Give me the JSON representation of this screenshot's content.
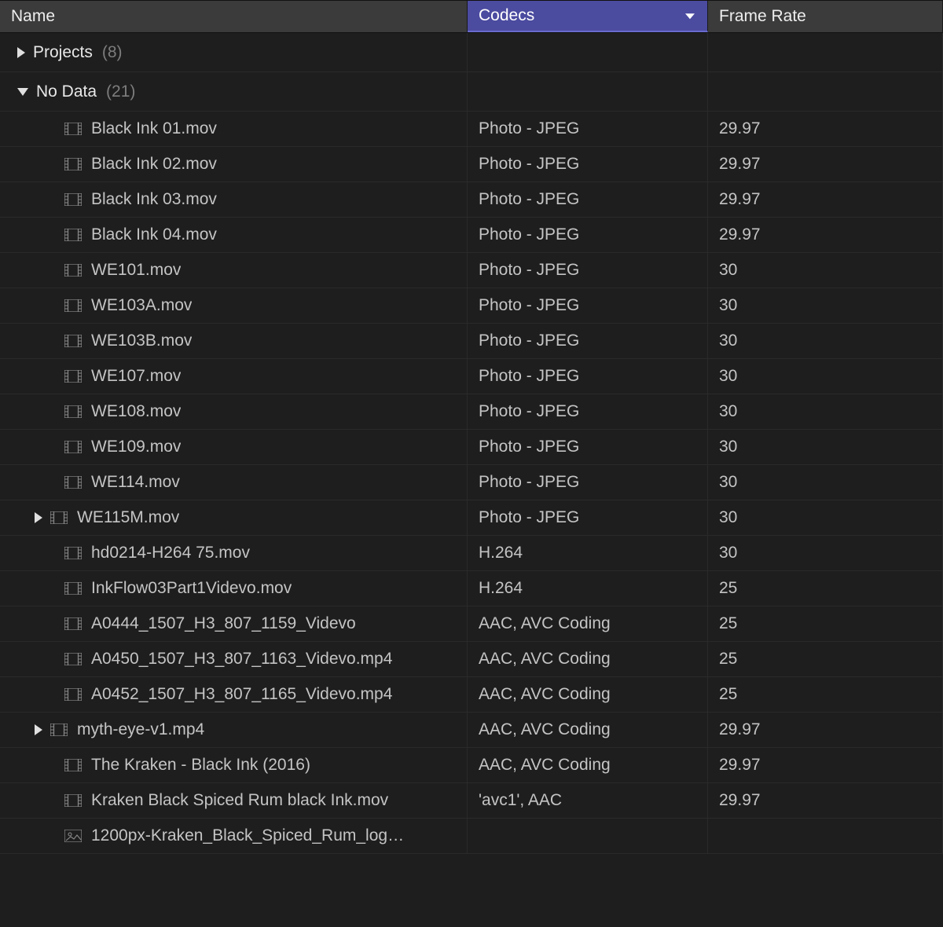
{
  "columns": {
    "name": "Name",
    "codecs": "Codecs",
    "rate": "Frame Rate"
  },
  "groups": [
    {
      "id": "projects",
      "label": "Projects",
      "count": "(8)",
      "expanded": false
    },
    {
      "id": "nodata",
      "label": "No Data",
      "count": "(21)",
      "expanded": true
    }
  ],
  "rows": [
    {
      "name": "Black Ink 01.mov",
      "codec": "Photo - JPEG",
      "rate": "29.97",
      "icon": "film",
      "disclosure": null
    },
    {
      "name": "Black Ink 02.mov",
      "codec": "Photo - JPEG",
      "rate": "29.97",
      "icon": "film",
      "disclosure": null
    },
    {
      "name": "Black Ink 03.mov",
      "codec": "Photo - JPEG",
      "rate": "29.97",
      "icon": "film",
      "disclosure": null
    },
    {
      "name": "Black Ink 04.mov",
      "codec": "Photo - JPEG",
      "rate": "29.97",
      "icon": "film",
      "disclosure": null
    },
    {
      "name": "WE101.mov",
      "codec": "Photo - JPEG",
      "rate": "30",
      "icon": "film",
      "disclosure": null
    },
    {
      "name": "WE103A.mov",
      "codec": "Photo - JPEG",
      "rate": "30",
      "icon": "film",
      "disclosure": null
    },
    {
      "name": "WE103B.mov",
      "codec": "Photo - JPEG",
      "rate": "30",
      "icon": "film",
      "disclosure": null
    },
    {
      "name": "WE107.mov",
      "codec": "Photo - JPEG",
      "rate": "30",
      "icon": "film",
      "disclosure": null
    },
    {
      "name": "WE108.mov",
      "codec": "Photo - JPEG",
      "rate": "30",
      "icon": "film",
      "disclosure": null
    },
    {
      "name": "WE109.mov",
      "codec": "Photo - JPEG",
      "rate": "30",
      "icon": "film",
      "disclosure": null
    },
    {
      "name": "WE114.mov",
      "codec": "Photo - JPEG",
      "rate": "30",
      "icon": "film",
      "disclosure": null
    },
    {
      "name": "WE115M.mov",
      "codec": "Photo - JPEG",
      "rate": "30",
      "icon": "film",
      "disclosure": "right"
    },
    {
      "name": "hd0214-H264 75.mov",
      "codec": "H.264",
      "rate": "30",
      "icon": "film",
      "disclosure": null
    },
    {
      "name": "InkFlow03Part1Videvo.mov",
      "codec": "H.264",
      "rate": "25",
      "icon": "film",
      "disclosure": null
    },
    {
      "name": "A0444_1507_H3_807_1159_Videvo",
      "codec": "AAC, AVC Coding",
      "rate": "25",
      "icon": "film",
      "disclosure": null
    },
    {
      "name": "A0450_1507_H3_807_1163_Videvo.mp4",
      "codec": "AAC, AVC Coding",
      "rate": "25",
      "icon": "film",
      "disclosure": null
    },
    {
      "name": "A0452_1507_H3_807_1165_Videvo.mp4",
      "codec": "AAC, AVC Coding",
      "rate": "25",
      "icon": "film",
      "disclosure": null
    },
    {
      "name": "myth-eye-v1.mp4",
      "codec": "AAC, AVC Coding",
      "rate": "29.97",
      "icon": "film",
      "disclosure": "right"
    },
    {
      "name": "The Kraken - Black Ink (2016)",
      "codec": "AAC, AVC Coding",
      "rate": "29.97",
      "icon": "film",
      "disclosure": null
    },
    {
      "name": "Kraken Black Spiced Rum   black Ink.mov",
      "codec": "'avc1', AAC",
      "rate": "29.97",
      "icon": "film",
      "disclosure": null
    },
    {
      "name": "1200px-Kraken_Black_Spiced_Rum_log…",
      "codec": "",
      "rate": "",
      "icon": "image",
      "disclosure": null
    }
  ]
}
